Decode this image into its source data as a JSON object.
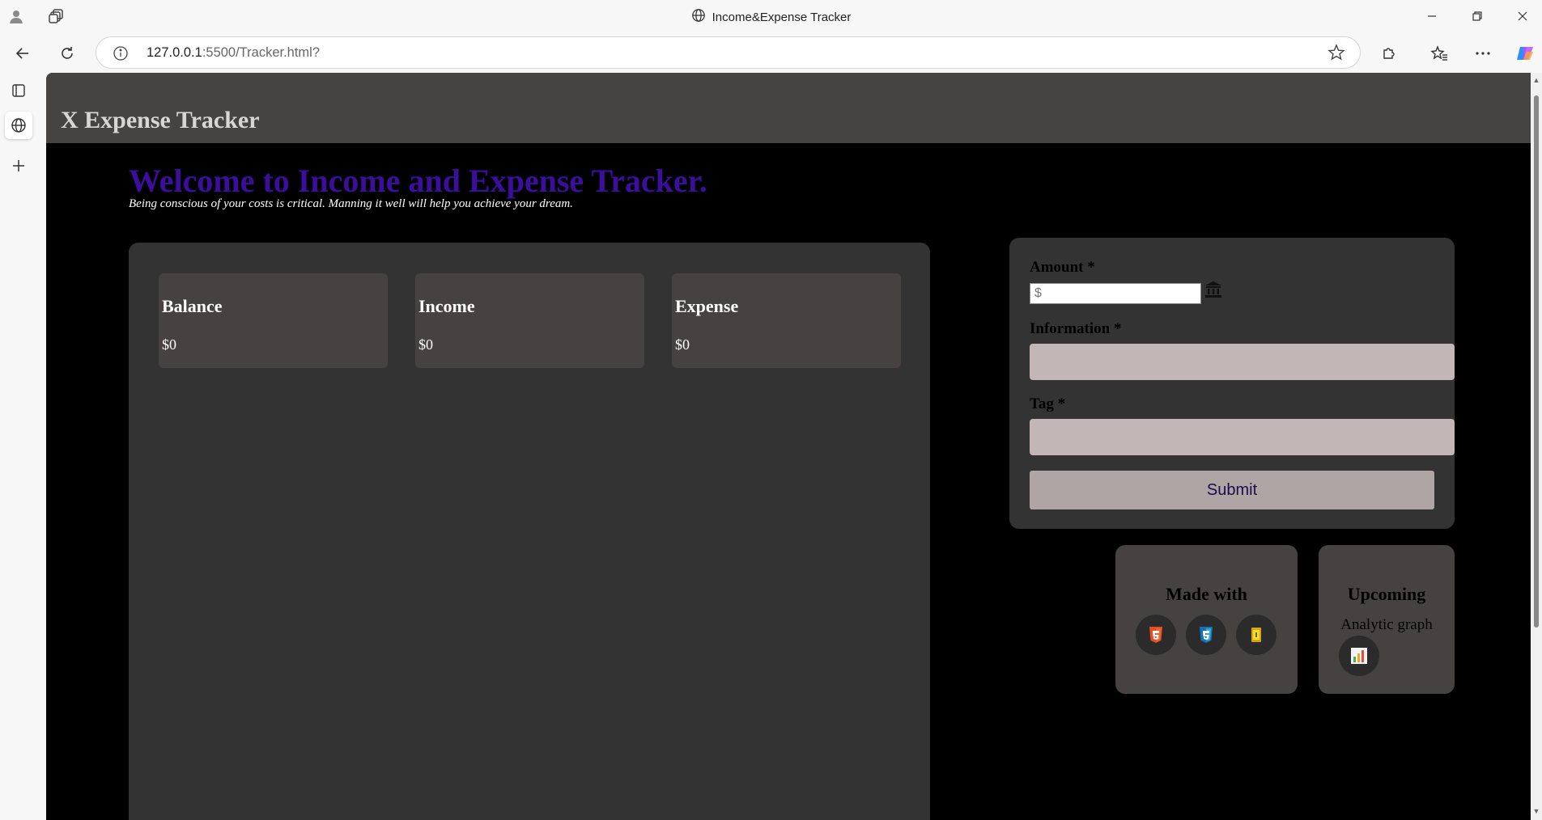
{
  "browser": {
    "tab_title": "Income&Expense Tracker",
    "url_host": "127.0.0.1",
    "url_path": ":5500/Tracker.html?"
  },
  "site": {
    "logo": "X Expense Tracker",
    "welcome": "Welcome to Income and Expense Tracker.",
    "subtitle": "Being conscious of your costs is critical. Manning it well will help you achieve your dream."
  },
  "stats": [
    {
      "title": "Balance",
      "value": "$0"
    },
    {
      "title": "Income",
      "value": "$0"
    },
    {
      "title": "Expense",
      "value": "$0"
    }
  ],
  "form": {
    "amount_label": "Amount *",
    "amount_placeholder": "$",
    "information_label": "Information *",
    "tag_label": "Tag *",
    "submit_label": "Submit"
  },
  "made_with": {
    "title": "Made with",
    "icons": [
      "html5-icon",
      "css3-icon",
      "javascript-icon"
    ]
  },
  "upcoming": {
    "title": "Upcoming",
    "text": "Analytic graph",
    "icon": "bar-chart-icon"
  }
}
